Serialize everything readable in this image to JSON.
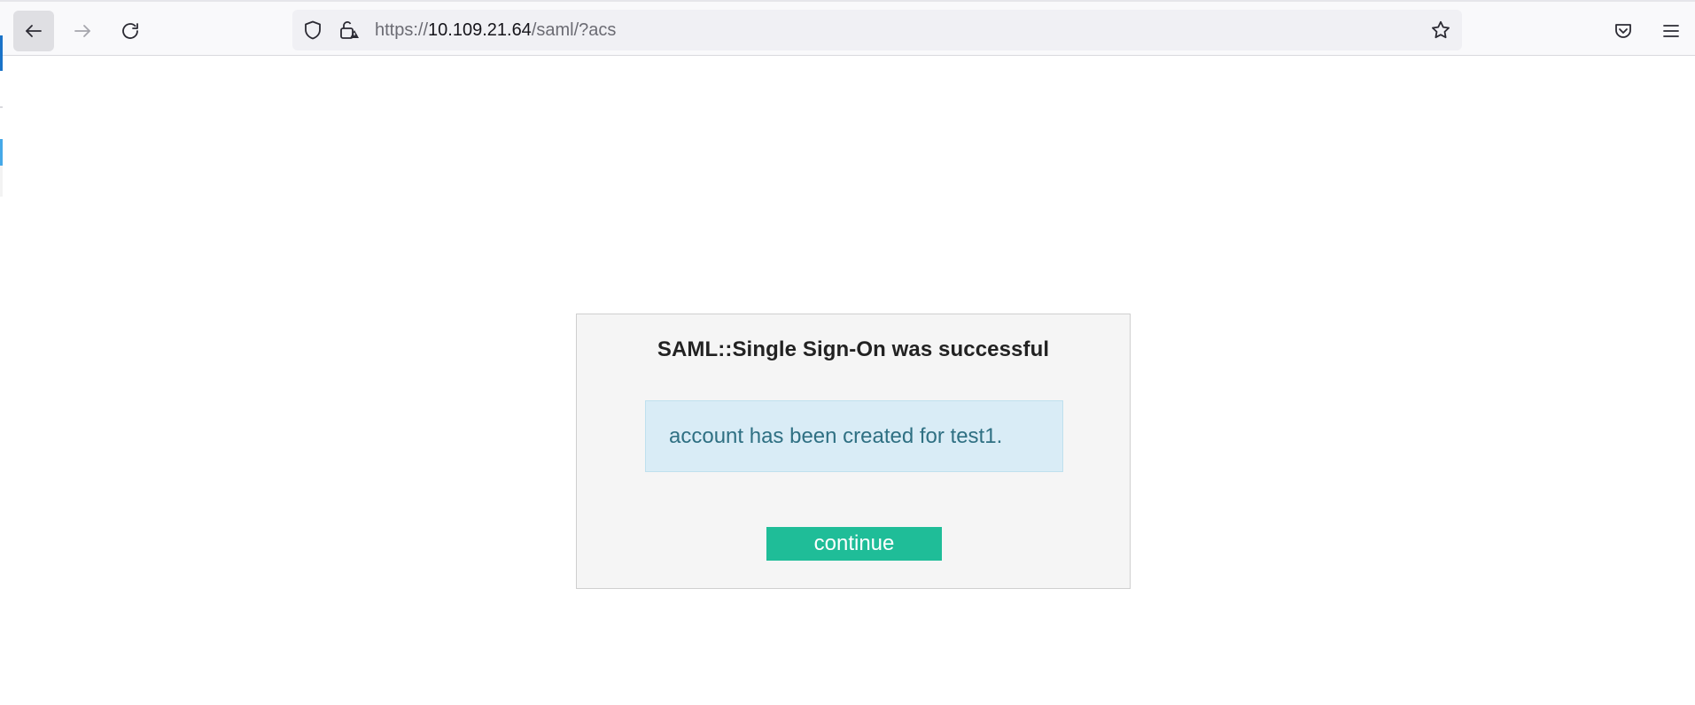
{
  "browser": {
    "url_scheme": "https://",
    "url_host": "10.109.21.64",
    "url_path": "/saml/?acs",
    "icons": {
      "back": "arrow-left-icon",
      "forward": "arrow-right-icon",
      "reload": "reload-icon",
      "tracking": "shield-icon",
      "security": "lock-warning-icon",
      "bookmark": "star-icon",
      "pocket": "pocket-icon",
      "menu": "hamburger-menu-icon"
    }
  },
  "dialog": {
    "title": "SAML::Single Sign-On was successful",
    "message": "account has been created for test1.",
    "continue_label": "continue"
  },
  "colors": {
    "accent_button": "#1fbd98",
    "alert_background": "#d9ecf6",
    "alert_text": "#2f7083"
  }
}
